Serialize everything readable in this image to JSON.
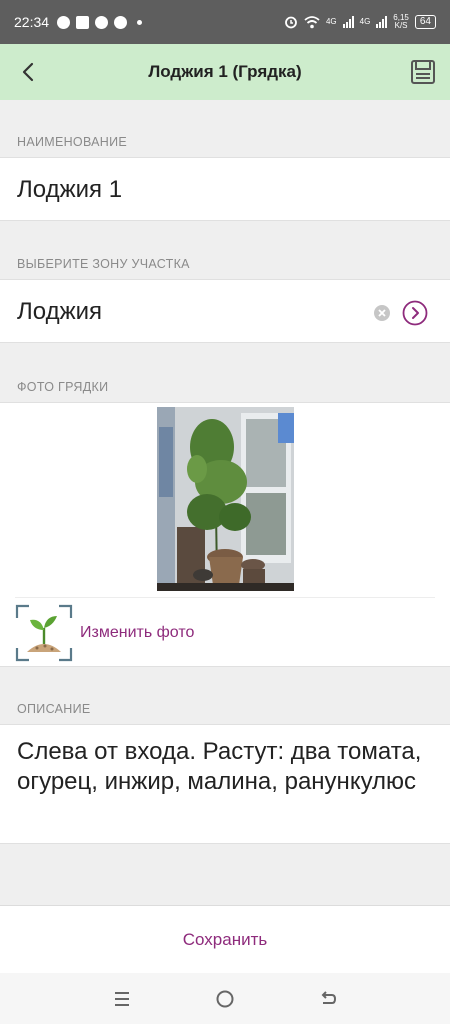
{
  "status_bar": {
    "time": "22:34",
    "net_4g_1": "4G",
    "net_4g_2": "4G",
    "speed_value": "6,15",
    "speed_unit": "K/S",
    "battery": "64"
  },
  "header": {
    "title": "Лоджия 1 (Грядка)"
  },
  "name_section": {
    "label": "НАИМЕНОВАНИЕ",
    "value": "Лоджия 1"
  },
  "zone_section": {
    "label": "ВЫБЕРИТЕ ЗОНУ УЧАСТКА",
    "value": "Лоджия"
  },
  "photo_section": {
    "label": "ФОТО ГРЯДКИ",
    "change_label": "Изменить фото"
  },
  "description_section": {
    "label": "ОПИСАНИЕ",
    "value": "Слева  от входа. Растут: два томата, огурец, инжир, малина, ранункулюс"
  },
  "footer": {
    "save_label": "Сохранить"
  },
  "colors": {
    "accent": "#8e2b7c",
    "appbar_bg": "#cdeccc",
    "status_bar_bg": "#5e5e5e"
  },
  "icons": [
    "back-arrow-icon",
    "save-disk-icon",
    "clear-icon",
    "chevron-right-icon",
    "plant-icon",
    "menu-icon",
    "home-icon",
    "back-icon"
  ]
}
